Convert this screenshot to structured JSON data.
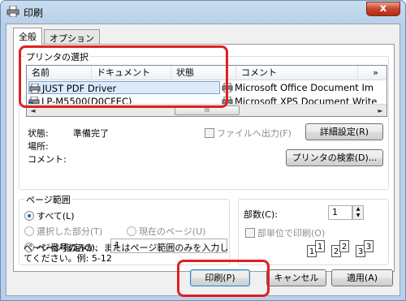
{
  "window": {
    "title": "印刷",
    "close_glyph": "x"
  },
  "tabs": [
    {
      "label": "全般"
    },
    {
      "label": "オプション"
    }
  ],
  "printer_group": {
    "label": "プリンタの選択"
  },
  "list_columns": [
    "名前",
    "ドキュメント",
    "状態",
    "コメント"
  ],
  "list_more": "»",
  "printers": [
    {
      "name": "JUST PDF Driver",
      "selected": true
    },
    {
      "name": "LP-M5500(D0CFEC)",
      "selected": false
    },
    {
      "name": "Microsoft Office Document Im",
      "selected": false
    },
    {
      "name": "Microsoft XPS Document Write",
      "selected": false
    }
  ],
  "scroll": {
    "left": "◄",
    "right": "►",
    "thumb": "III"
  },
  "status": {
    "status_label": "状態:",
    "status_value": "準備完了",
    "location_label": "場所:",
    "comment_label": "コメント:"
  },
  "print_to_file_label": "ファイルへ出力(F)",
  "detail_settings_label": "詳細設定(R)",
  "find_printer_label": "プリンタの検索(D)...",
  "range_group": {
    "label": "ページ範囲",
    "all_label": "すべて(L)",
    "selection_label": "選択した部分(T)",
    "current_label": "現在のページ(U)",
    "pages_label": "ページ指定(G):",
    "pages_value": "1",
    "help_line1": "ページ番号のみか、またはページ範囲のみを入力し",
    "help_line2": "てください。例: 5-12"
  },
  "copies": {
    "label": "部数(C):",
    "value": "1",
    "up": "▲",
    "down": "▼",
    "collate_label": "部単位で印刷(O)",
    "collate_pages": [
      "1",
      "1",
      "2",
      "2",
      "3",
      "3"
    ]
  },
  "buttons": {
    "print": "印刷(P)",
    "cancel": "キャンセル",
    "apply": "適用(A)"
  },
  "colors": {
    "highlight": "#e02020",
    "accent": "#3c7fb1"
  }
}
